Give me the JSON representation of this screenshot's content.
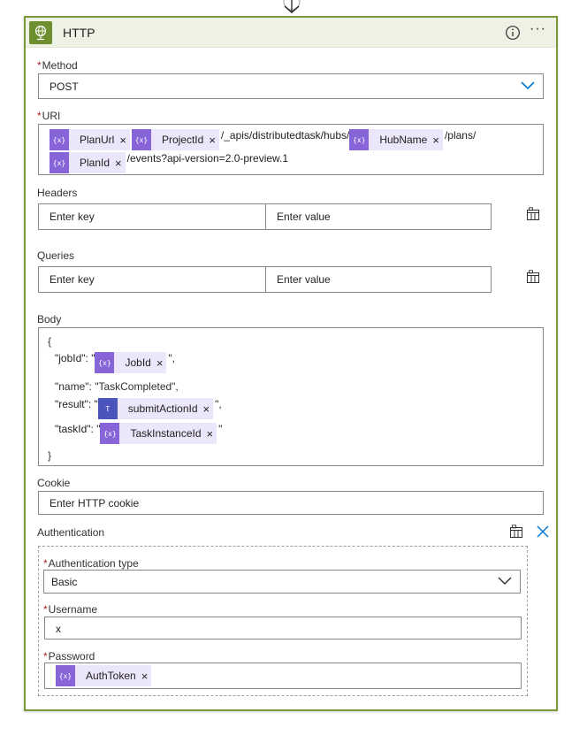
{
  "header": {
    "title": "HTTP",
    "info_icon": "info-icon",
    "more_icon": "more-icon",
    "more_label": "···"
  },
  "method": {
    "label": "Method",
    "required": "*",
    "value": "POST"
  },
  "uri": {
    "label": "URI",
    "required": "*",
    "tokens": {
      "plan_url": "PlanUrl",
      "project_id": "ProjectId",
      "hub_name": "HubName",
      "plan_id": "PlanId"
    },
    "text1": "/_apis/distributedtask/hubs/",
    "text2": "/plans/",
    "text3": "/events?api-version=2.0-preview.1"
  },
  "headers": {
    "label": "Headers",
    "key_placeholder": "Enter key",
    "value_placeholder": "Enter value"
  },
  "queries": {
    "label": "Queries",
    "key_placeholder": "Enter key",
    "value_placeholder": "Enter value"
  },
  "body": {
    "label": "Body",
    "open_brace": "{",
    "close_brace": "}",
    "line1_prefix": "\"jobId\": \"",
    "line1_token": "JobId",
    "line1_suffix": "\",",
    "line2": "\"name\": \"TaskCompleted\",",
    "line3_prefix": "\"result\": \"",
    "line3_token": "submitActionId",
    "line3_suffix": "\",",
    "line4_prefix": "\"taskId\": \"",
    "line4_token": "TaskInstanceId",
    "line4_suffix": "\""
  },
  "cookie": {
    "label": "Cookie",
    "placeholder": "Enter HTTP cookie"
  },
  "authentication": {
    "label": "Authentication",
    "type_label": "Authentication type",
    "type_value": "Basic",
    "username_label": "Username",
    "username_value": "x",
    "password_label": "Password",
    "password_token": "AuthToken",
    "required": "*"
  },
  "token_icon_text": "{x}",
  "remove_glyph": "×",
  "colors": {
    "card_border": "#7a9a3a",
    "header_bg": "#eef2e4",
    "token_bg": "#ece6fa",
    "token_icon": "#8764d8",
    "teams_icon": "#4b53bc",
    "required": "#a4262c",
    "link_blue": "#0078d4"
  }
}
